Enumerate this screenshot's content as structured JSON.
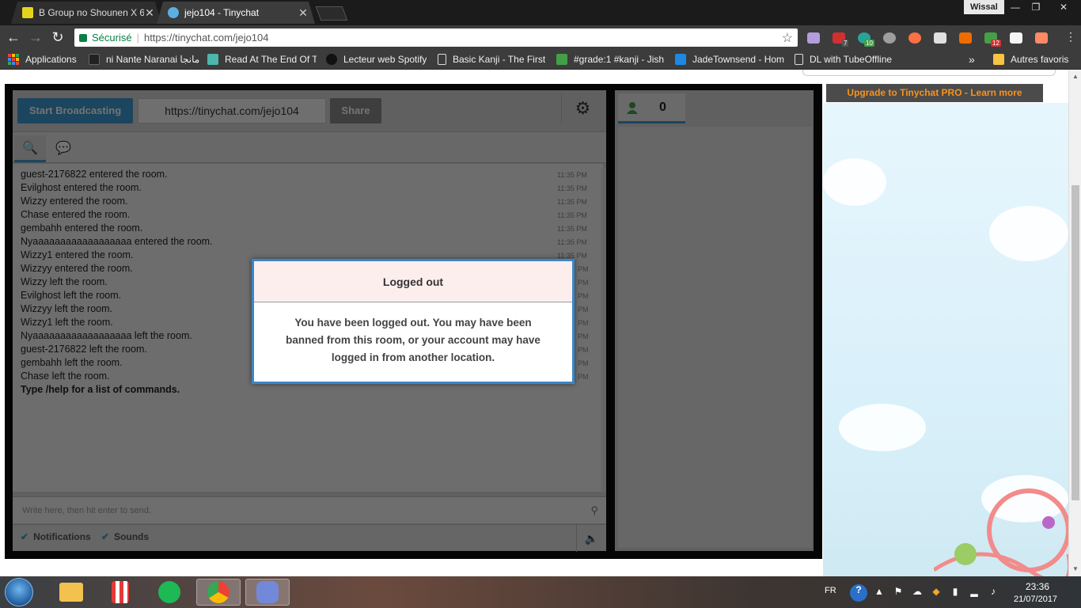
{
  "browser": {
    "tabs": [
      {
        "title": "B Group no Shounen X 6",
        "active": false,
        "favicon_color": "#e6d41a"
      },
      {
        "title": "jejo104 - Tinychat",
        "active": true,
        "favicon_color": "#5ab0e0"
      }
    ],
    "close_glyph": "✕",
    "profile_name": "Wissal",
    "window_buttons": {
      "minimize": "—",
      "restore": "❐",
      "close": "✕"
    },
    "nav": {
      "back": "←",
      "forward": "→",
      "reload": "↻"
    },
    "omnibox": {
      "secure_label": "Sécurisé",
      "separator": "|",
      "url": "https://tinychat.com/jejo104",
      "star": "☆"
    },
    "extensions": [
      {
        "name": "ext-purple-icon",
        "color": "#b39ddb"
      },
      {
        "name": "abp-icon",
        "color": "#d32f2f",
        "badge": "7"
      },
      {
        "name": "ext-teal-icon",
        "color": "#26a69a",
        "badge": "10"
      },
      {
        "name": "ext-moon-icon",
        "color": "#9e9e9e"
      },
      {
        "name": "ext-flame-icon",
        "color": "#ff7043"
      },
      {
        "name": "ext-mail-icon",
        "color": "#e0e0e0"
      },
      {
        "name": "ext-wrench-icon",
        "color": "#ef6c00"
      },
      {
        "name": "ext-green-icon",
        "color": "#43a047",
        "badge": "12"
      },
      {
        "name": "ext-white-icon",
        "color": "#f5f5f5"
      },
      {
        "name": "ext-orange-icon",
        "color": "#ff8a65"
      }
    ],
    "menu_glyph": "⋮",
    "bookmarks": [
      {
        "label": "Applications",
        "type": "apps"
      },
      {
        "label": "ni Nante Naranai مانجا",
        "color": "#222"
      },
      {
        "label": "Read At The End Of T",
        "color": "#4db6ac"
      },
      {
        "label": "Lecteur web Spotify",
        "color": "#111"
      },
      {
        "label": "Basic Kanji - The First",
        "color": "#ddd"
      },
      {
        "label": "#grade:1 #kanji - Jish",
        "color": "#43a047"
      },
      {
        "label": "JadeTownsend - Hom",
        "color": "#1e88e5"
      },
      {
        "label": "DL with TubeOffline",
        "color": "#ddd"
      }
    ],
    "bookmarks_more": "»",
    "other_bookmarks": "Autres favoris"
  },
  "tinychat": {
    "upgrade_banner": "Upgrade to Tinychat PRO - Learn more",
    "start_broadcasting": "Start Broadcasting",
    "room_url": "https://tinychat.com/jejo104",
    "share": "Share",
    "settings_glyph": "⚙",
    "subtab_glyphs": [
      "🔍",
      "💬"
    ],
    "chat_messages": [
      {
        "text": "guest-2176822 entered the room.",
        "time": "11:35 PM"
      },
      {
        "text": "Evilghost entered the room.",
        "time": "11:35 PM"
      },
      {
        "text": "Wizzy entered the room.",
        "time": "11:35 PM"
      },
      {
        "text": "Chase entered the room.",
        "time": "11:35 PM"
      },
      {
        "text": "gembahh entered the room.",
        "time": "11:35 PM"
      },
      {
        "text": "Nyaaaaaaaaaaaaaaaaaa entered the room.",
        "time": "11:35 PM"
      },
      {
        "text": "Wizzy1 entered the room.",
        "time": "11:35 PM"
      },
      {
        "text": "Wizzyy entered the room.",
        "time": "PM"
      },
      {
        "text": "Wizzy left the room.",
        "time": "PM"
      },
      {
        "text": "Evilghost left the room.",
        "time": "PM"
      },
      {
        "text": "Wizzyy left the room.",
        "time": "PM"
      },
      {
        "text": "Wizzy1 left the room.",
        "time": "PM"
      },
      {
        "text": "Nyaaaaaaaaaaaaaaaaaa left the room.",
        "time": "PM"
      },
      {
        "text": "guest-2176822 left the room.",
        "time": "PM"
      },
      {
        "text": "gembahh left the room.",
        "time": "PM"
      },
      {
        "text": "Chase left the room.",
        "time": "PM"
      },
      {
        "text": "Type /help for a list of commands.",
        "time": "",
        "bold": true
      }
    ],
    "chat_placeholder": "Write here, then hit enter to send.",
    "notifications_label": "Notifications",
    "sounds_label": "Sounds",
    "check_glyph": "✔",
    "speaker_glyph": "🔈",
    "user_count": "0",
    "modal": {
      "title": "Logged out",
      "message": "You have been logged out. You may have been banned from this room, or your account may have logged in from another location."
    }
  },
  "taskbar": {
    "apps": [
      {
        "name": "explorer",
        "color": "#f2c14e",
        "active": false
      },
      {
        "name": "popcorn",
        "color": "#e53935",
        "active": false
      },
      {
        "name": "spotify",
        "color": "#1db954",
        "active": false
      },
      {
        "name": "chrome",
        "color": "#4285f4",
        "active": true
      },
      {
        "name": "discord",
        "color": "#7289da",
        "active": true
      }
    ],
    "language": "FR",
    "time": "23:36",
    "date": "21/07/2017"
  }
}
